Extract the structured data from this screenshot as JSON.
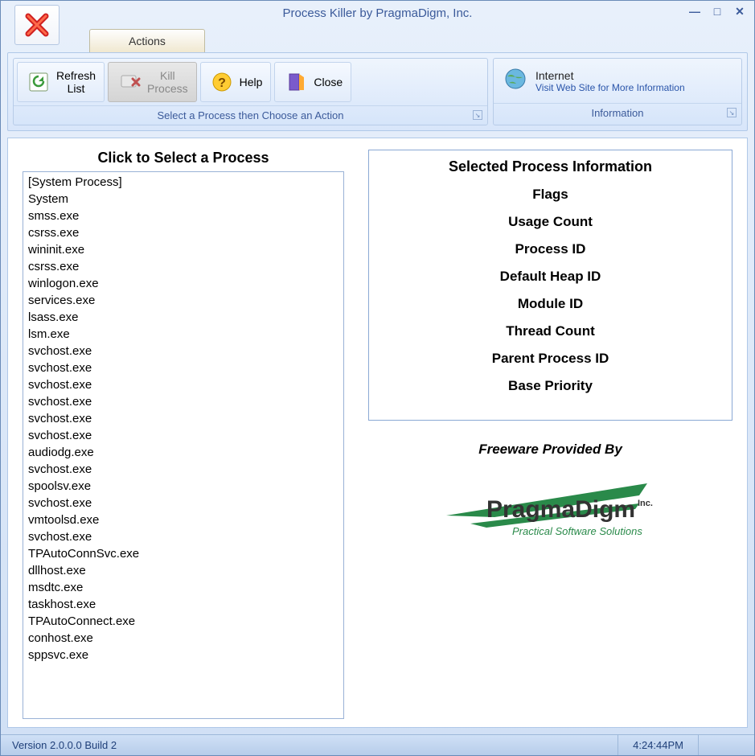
{
  "window": {
    "title": "Process Killer by PragmaDigm, Inc."
  },
  "tab": {
    "label": "Actions"
  },
  "ribbon": {
    "refresh": "Refresh\nList",
    "kill": "Kill\nProcess",
    "help": "Help",
    "close": "Close",
    "actions_caption": "Select a Process then Choose an Action",
    "internet_title": "Internet",
    "internet_link": "Visit Web Site for More Information",
    "info_caption": "Information"
  },
  "left": {
    "heading": "Click to Select a Process",
    "processes": [
      "[System Process]",
      "System",
      "smss.exe",
      "csrss.exe",
      "wininit.exe",
      "csrss.exe",
      "winlogon.exe",
      "services.exe",
      "lsass.exe",
      "lsm.exe",
      "svchost.exe",
      "svchost.exe",
      "svchost.exe",
      "svchost.exe",
      "svchost.exe",
      "svchost.exe",
      "audiodg.exe",
      "svchost.exe",
      "spoolsv.exe",
      "svchost.exe",
      "vmtoolsd.exe",
      "svchost.exe",
      "TPAutoConnSvc.exe",
      "dllhost.exe",
      "msdtc.exe",
      "taskhost.exe",
      "TPAutoConnect.exe",
      "conhost.exe",
      "sppsvc.exe"
    ]
  },
  "right": {
    "heading": "Selected Process Information",
    "fields": [
      "Flags",
      "Usage Count",
      "Process ID",
      "Default Heap ID",
      "Module ID",
      "Thread Count",
      "Parent Process ID",
      "Base Priority"
    ],
    "freeware": "Freeware Provided By",
    "logo_name": "PragmaDigm",
    "logo_suffix": "Inc.",
    "logo_tagline": "Practical Software Solutions"
  },
  "status": {
    "version": "Version 2.0.0.0 Build 2",
    "time": "4:24:44PM"
  }
}
